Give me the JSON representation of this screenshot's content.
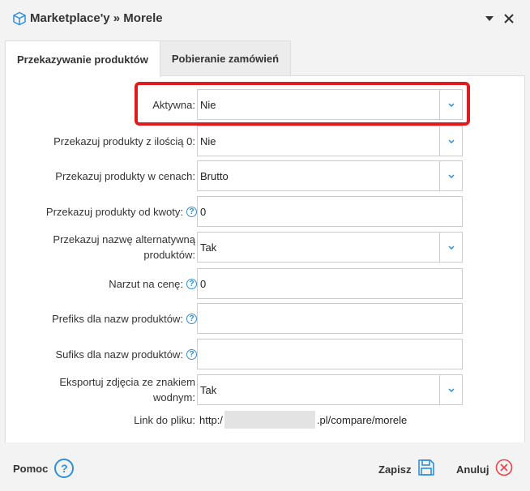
{
  "window": {
    "title": "Marketplace'y » Morele",
    "icon": "box-icon"
  },
  "tabs": [
    {
      "label": "Przekazywanie produktów",
      "active": true
    },
    {
      "label": "Pobieranie zamówień",
      "active": false
    }
  ],
  "form": {
    "aktywna": {
      "label": "Aktywna:",
      "value": "Nie"
    },
    "ilosc0": {
      "label": "Przekazuj produkty z ilością 0:",
      "value": "Nie"
    },
    "cenach": {
      "label": "Przekazuj produkty w cenach:",
      "value": "Brutto"
    },
    "kwoty": {
      "label": "Przekazuj produkty od kwoty:",
      "value": "0"
    },
    "nazwa_alt": {
      "label_line1": "Przekazuj nazwę alternatywną",
      "label_line2": "produktów:",
      "value": "Tak"
    },
    "narzut": {
      "label": "Narzut na cenę:",
      "value": "0"
    },
    "prefiks": {
      "label": "Prefiks dla nazw produktów:",
      "value": ""
    },
    "sufiks": {
      "label": "Sufiks dla nazw produktów:",
      "value": ""
    },
    "zdjecia": {
      "label_line1": "Eksportuj zdjęcia ze znakiem",
      "label_line2": "wodnym:",
      "value": "Tak"
    },
    "link": {
      "label": "Link do pliku:",
      "prefix": "http:/",
      "suffix": ".pl/compare/morele"
    }
  },
  "footer": {
    "help_label": "Pomoc",
    "save_label": "Zapisz",
    "cancel_label": "Anuluj"
  },
  "colors": {
    "accent_blue": "#2f8fd8",
    "highlight_red": "#e01b1b",
    "cancel_red": "#e8434b"
  }
}
